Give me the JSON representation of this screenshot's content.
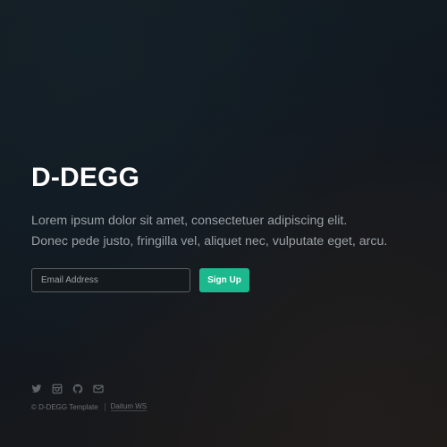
{
  "hero": {
    "title": "D-DEGG",
    "lead_line1": "Lorem ipsum dolor sit amet, consectetuer adipiscing elit.",
    "lead_line2": "Donec pede justo, fringilla vel, aliquet nec, vulputate eget, arcu."
  },
  "signup": {
    "email_placeholder": "Email Address",
    "button_label": "Sign Up",
    "accent_color": "#1cb98f"
  },
  "footer": {
    "social_icons": [
      "twitter-icon",
      "instagram-icon",
      "github-icon",
      "mail-icon"
    ],
    "copyright": "© D-DEGG Template",
    "credit_link": "Daitum WS"
  }
}
